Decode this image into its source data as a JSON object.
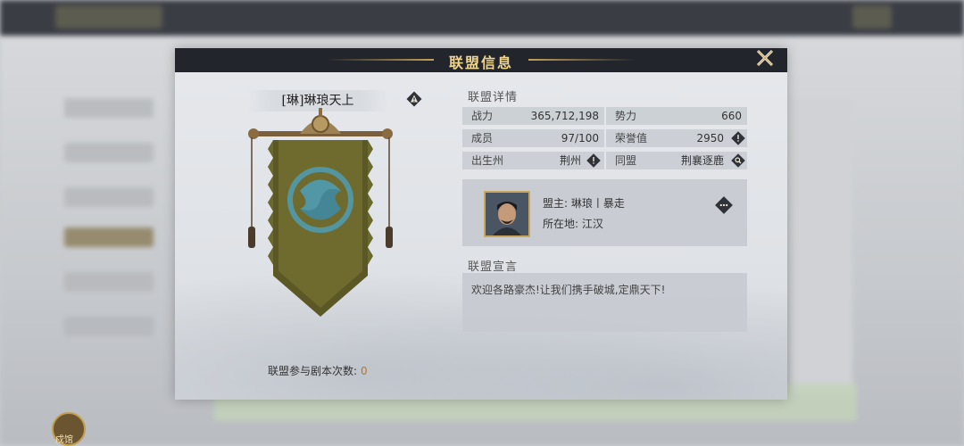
{
  "dialog": {
    "title": "联盟信息",
    "close_icon": "close-icon"
  },
  "alliance": {
    "name": "[琳]琳琅天上",
    "participation_label": "联盟参与剧本次数:",
    "participation_count": "0"
  },
  "details": {
    "title": "联盟详情",
    "stats": [
      {
        "label": "战力",
        "value": "365,712,198"
      },
      {
        "label": "势力",
        "value": "660"
      },
      {
        "label": "成员",
        "value": "97/100"
      },
      {
        "label": "荣誉值",
        "value": "2950"
      },
      {
        "label": "出生州",
        "value": "荆州"
      },
      {
        "label": "同盟",
        "value": "荆襄逐鹿"
      }
    ]
  },
  "leader": {
    "name_line": "盟主: 琳琅丨暴走",
    "location_line": "所在地: 江汉"
  },
  "declaration": {
    "title": "联盟宣言",
    "text": "欢迎各路豪杰!让我们携手破城,定鼎天下!"
  },
  "background": {
    "avatar_label": "戍馆"
  },
  "colors": {
    "title_gold": "#f0d58f",
    "banner_green": "#6f6a2e",
    "emblem_blue": "#4f9cb4",
    "accent_orange": "#c0722f"
  }
}
